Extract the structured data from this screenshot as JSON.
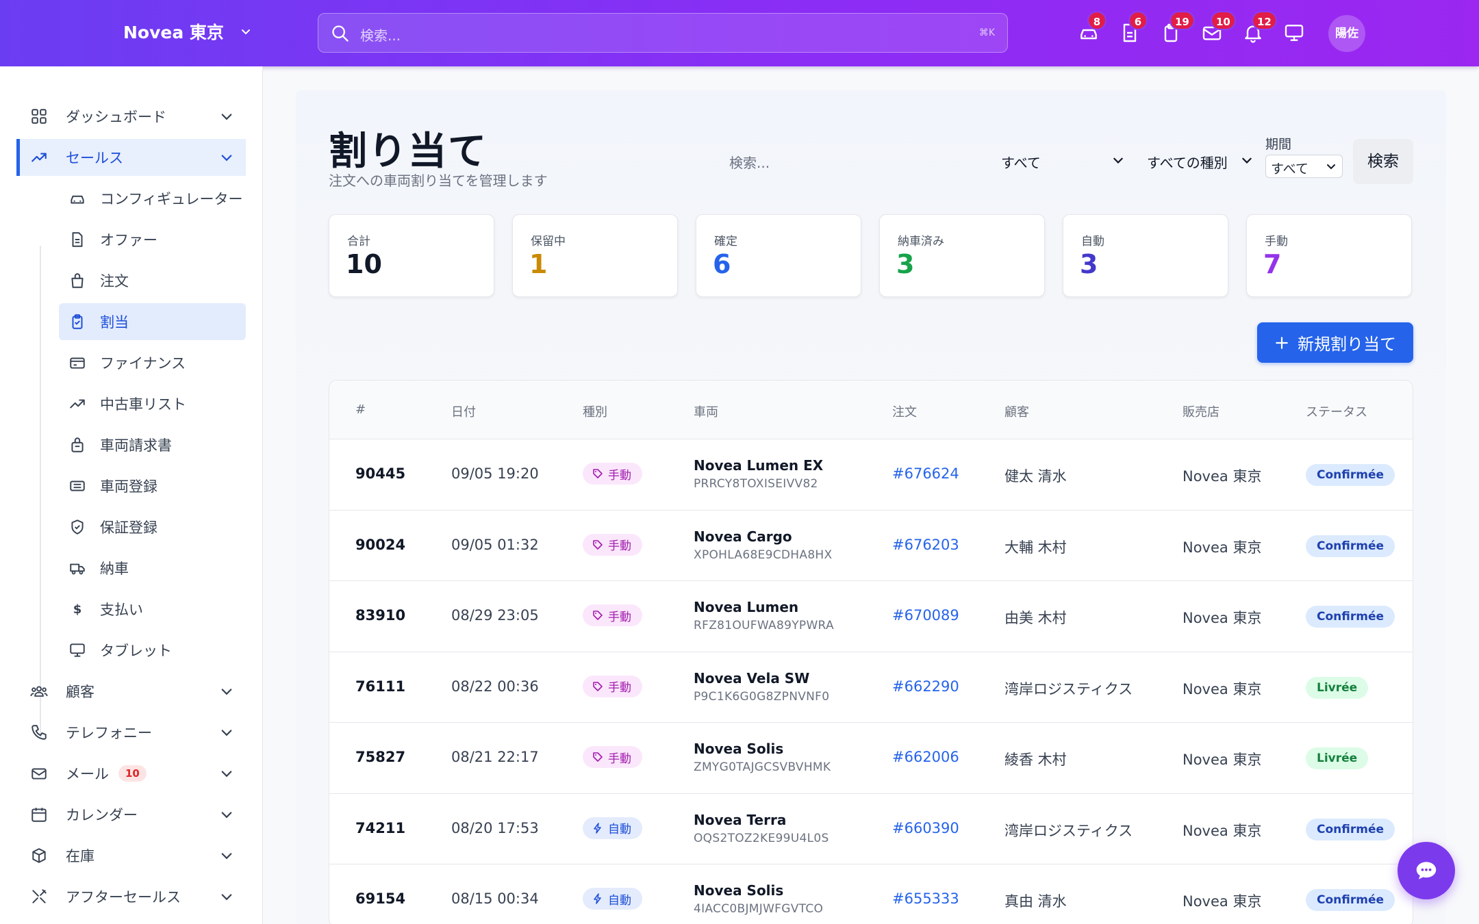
{
  "header": {
    "brand": "Novea 東京",
    "search_placeholder": "検索...",
    "shortcut": "⌘K",
    "icons": [
      {
        "name": "car-icon",
        "badge": "8"
      },
      {
        "name": "document-icon",
        "badge": "6"
      },
      {
        "name": "clipboard-icon",
        "badge": "19"
      },
      {
        "name": "mail-icon",
        "badge": "10"
      },
      {
        "name": "bell-icon",
        "badge": "12"
      },
      {
        "name": "monitor-icon",
        "badge": ""
      }
    ],
    "avatar": "陽佐"
  },
  "sidebar": {
    "top_items": [
      {
        "label": "ダッシュボード",
        "icon": "grid-icon"
      },
      {
        "label": "セールス",
        "icon": "trending-up-icon",
        "active": true
      }
    ],
    "sub_items": [
      {
        "label": "コンフィギュレーター",
        "icon": "car-icon"
      },
      {
        "label": "オファー",
        "icon": "document-icon"
      },
      {
        "label": "注文",
        "icon": "bag-icon"
      },
      {
        "label": "割当",
        "icon": "clipboard-check-icon",
        "active": true
      },
      {
        "label": "ファイナンス",
        "icon": "credit-card-icon"
      },
      {
        "label": "中古車リスト",
        "icon": "trending-icon"
      },
      {
        "label": "車両請求書",
        "icon": "lock-bag-icon"
      },
      {
        "label": "車両登録",
        "icon": "id-card-icon"
      },
      {
        "label": "保証登録",
        "icon": "shield-check-icon"
      },
      {
        "label": "納車",
        "icon": "truck-icon"
      },
      {
        "label": "支払い",
        "icon": "dollar-icon"
      },
      {
        "label": "タブレット",
        "icon": "monitor-icon"
      }
    ],
    "bottom_items": [
      {
        "label": "顧客",
        "icon": "users-icon"
      },
      {
        "label": "テレフォニー",
        "icon": "phone-icon"
      },
      {
        "label": "メール",
        "icon": "mail-icon",
        "badge": "10"
      },
      {
        "label": "カレンダー",
        "icon": "calendar-icon"
      },
      {
        "label": "在庫",
        "icon": "box-icon"
      },
      {
        "label": "アフターセールス",
        "icon": "tools-icon"
      }
    ]
  },
  "page": {
    "title": "割り当て",
    "subtitle": "注文への車両割り当てを管理します",
    "filter_search_placeholder": "検索...",
    "status_filter": "すべて",
    "type_filter": "すべての種別",
    "period_label": "期間",
    "period_value": "すべて",
    "search_button": "検索",
    "new_button": "新規割り当て"
  },
  "stats": [
    {
      "label": "合計",
      "value": "10",
      "color": "#111827"
    },
    {
      "label": "保留中",
      "value": "1",
      "color": "#ca8a04"
    },
    {
      "label": "確定",
      "value": "6",
      "color": "#2563eb"
    },
    {
      "label": "納車済み",
      "value": "3",
      "color": "#16a34a"
    },
    {
      "label": "自動",
      "value": "3",
      "color": "#4338ca"
    },
    {
      "label": "手動",
      "value": "7",
      "color": "#9333ea"
    }
  ],
  "table": {
    "columns": [
      "#",
      "日付",
      "種別",
      "車両",
      "注文",
      "顧客",
      "販売店",
      "ステータス"
    ],
    "rows": [
      {
        "id": "90445",
        "date": "09/05 19:20",
        "type": "手動",
        "type_kind": "manual",
        "vehicle": "Novea Lumen EX",
        "vin": "PRRCY8TOXISEIVV82",
        "order": "#676624",
        "customer": "健太 清水",
        "dealer": "Novea 東京",
        "status": "Confirmée",
        "status_kind": "conf"
      },
      {
        "id": "90024",
        "date": "09/05 01:32",
        "type": "手動",
        "type_kind": "manual",
        "vehicle": "Novea Cargo",
        "vin": "XPOHLA68E9CDHA8HX",
        "order": "#676203",
        "customer": "大輔 木村",
        "dealer": "Novea 東京",
        "status": "Confirmée",
        "status_kind": "conf"
      },
      {
        "id": "83910",
        "date": "08/29 23:05",
        "type": "手動",
        "type_kind": "manual",
        "vehicle": "Novea Lumen",
        "vin": "RFZ81OUFWA89YPWRA",
        "order": "#670089",
        "customer": "由美 木村",
        "dealer": "Novea 東京",
        "status": "Confirmée",
        "status_kind": "conf"
      },
      {
        "id": "76111",
        "date": "08/22 00:36",
        "type": "手動",
        "type_kind": "manual",
        "vehicle": "Novea Vela SW",
        "vin": "P9C1K6G0G8ZPNVNF0",
        "order": "#662290",
        "customer": "湾岸ロジスティクス",
        "dealer": "Novea 東京",
        "status": "Livrée",
        "status_kind": "livr"
      },
      {
        "id": "75827",
        "date": "08/21 22:17",
        "type": "手動",
        "type_kind": "manual",
        "vehicle": "Novea Solis",
        "vin": "ZMYG0TAJGCSVBVHMK",
        "order": "#662006",
        "customer": "綾香 木村",
        "dealer": "Novea 東京",
        "status": "Livrée",
        "status_kind": "livr"
      },
      {
        "id": "74211",
        "date": "08/20 17:53",
        "type": "自動",
        "type_kind": "auto",
        "vehicle": "Novea Terra",
        "vin": "OQS2TOZ2KE99U4L0S",
        "order": "#660390",
        "customer": "湾岸ロジスティクス",
        "dealer": "Novea 東京",
        "status": "Confirmée",
        "status_kind": "conf"
      },
      {
        "id": "69154",
        "date": "08/15 00:34",
        "type": "自動",
        "type_kind": "auto",
        "vehicle": "Novea Solis",
        "vin": "4IACC0BJMJWFGVTCO",
        "order": "#655333",
        "customer": "真由 清水",
        "dealer": "Novea 東京",
        "status": "Confirmée",
        "status_kind": "conf"
      }
    ]
  }
}
